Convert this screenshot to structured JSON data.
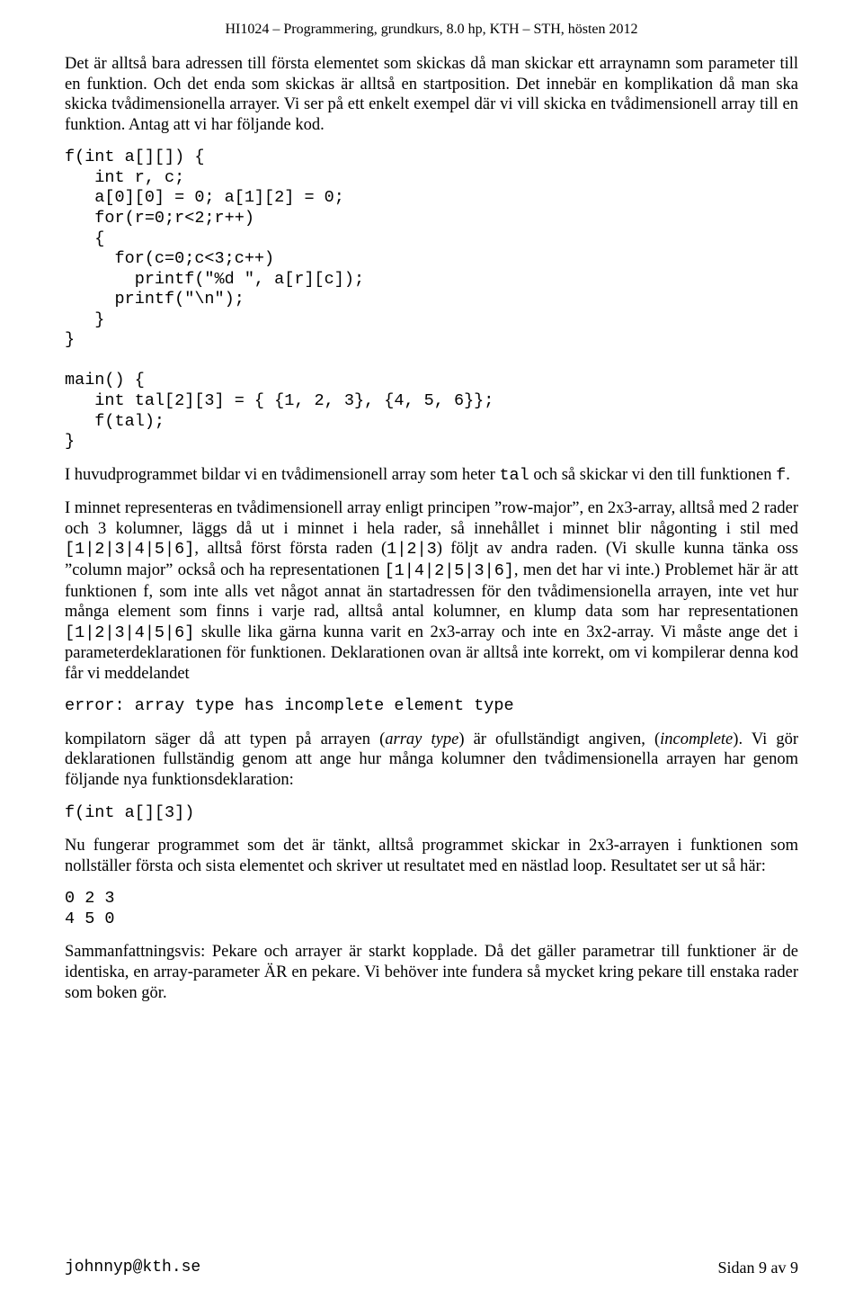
{
  "header": "HI1024 – Programmering, grundkurs, 8.0 hp, KTH – STH, hösten 2012",
  "para1": "Det är alltså bara adressen till första elementet som skickas då man skickar ett arraynamn som parameter till en funktion. Och det enda som skickas är alltså en startposition. Det innebär en komplikation då man ska skicka tvådimensionella arrayer. Vi ser på ett enkelt exempel där vi vill skicka en tvådimensionell array till en funktion. Antag att vi har följande kod.",
  "code1": "f(int a[][]) {\n   int r, c;\n   a[0][0] = 0; a[1][2] = 0;\n   for(r=0;r<2;r++)\n   {\n     for(c=0;c<3;c++)\n       printf(\"%d \", a[r][c]);\n     printf(\"\\n\");\n   }\n}\n\nmain() {\n   int tal[2][3] = { {1, 2, 3}, {4, 5, 6}};\n   f(tal);\n}",
  "para2_a": "I huvudprogrammet bildar vi en tvådimensionell array som heter ",
  "para2_b": " och så skickar vi den till funktionen ",
  "para2_c": ".",
  "tal": "tal",
  "f": "f",
  "para3_a": "I minnet representeras en tvådimensionell array enligt principen ”row-major”, en 2x3-array, alltså med 2 rader och 3 kolumner, läggs då ut i minnet i hela rader, så innehållet i minnet blir någonting i stil med ",
  "seq1": "[1|2|3|4|5|6]",
  "para3_b": ", alltså först första raden (",
  "seq2": "1|2|3",
  "para3_c": ") följt av andra raden. (Vi skulle kunna tänka oss ”column major” också och ha representationen ",
  "seq3": "[1|4|2|5|3|6]",
  "para3_d": ", men det har vi inte.) Problemet här är att funktionen f, som inte alls vet något annat än startadressen för den tvådimensionella arrayen, inte vet hur många element som finns i varje rad, alltså antal kolumner, en klump data som har representationen ",
  "seq4": "[1|2|3|4|5|6]",
  "para3_e": " skulle lika gärna kunna varit en 2x3-array och inte en 3x2-array. Vi måste ange det i parameterdeklarationen för funktionen. Deklarationen ovan är alltså inte korrekt, om vi kompilerar denna kod får vi meddelandet",
  "code2": "error: array type has incomplete element type",
  "para4_a": "kompilatorn säger då att typen på arrayen (",
  "para4_b": ") är ofullständigt angiven, (",
  "para4_c": "). Vi gör deklarationen fullständig genom att ange hur många kolumner den tvådimensionella arrayen har genom följande nya funktionsdeklaration:",
  "arraytype": "array type",
  "incomplete": "incomplete",
  "code3": "f(int a[][3])",
  "para5": "Nu fungerar programmet som det är tänkt, alltså programmet skickar in 2x3-arrayen i funktionen som nollställer första och sista elementet och skriver ut resultatet med en nästlad loop. Resultatet ser ut så här:",
  "output": "0 2 3\n4 5 0",
  "para6": "Sammanfattningsvis: Pekare och arrayer är starkt kopplade. Då det gäller parametrar till funktioner är de identiska, en array-parameter ÄR en pekare. Vi behöver inte fundera så mycket kring pekare till enstaka rader som boken gör.",
  "footer_left": "johnnyp@kth.se",
  "footer_right": "Sidan 9 av 9"
}
